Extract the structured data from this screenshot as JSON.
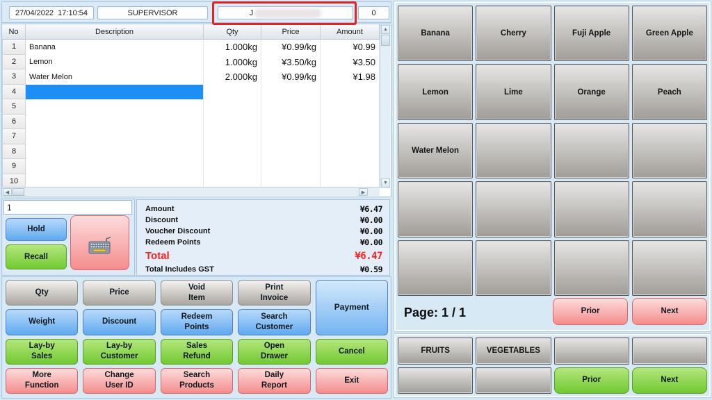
{
  "colors": {
    "selection_blue": "#1e8ef7",
    "annotation_red": "#e32222",
    "total_red": "#ff2020"
  },
  "topbar": {
    "datetime": "27/04/2022  17:10:54",
    "operator": "SUPERVISOR",
    "customer_name": "J",
    "counter": "0"
  },
  "sales_table": {
    "headers": [
      "No",
      "Description",
      "Qty",
      "Price",
      "Amount"
    ],
    "selected_row_no": "4",
    "rows": [
      {
        "no": "1",
        "description": "Banana",
        "qty": "1.000kg",
        "price": "¥0.99/kg",
        "amount": "¥0.99"
      },
      {
        "no": "2",
        "description": "Lemon",
        "qty": "1.000kg",
        "price": "¥3.50/kg",
        "amount": "¥3.50"
      },
      {
        "no": "3",
        "description": "Water Melon",
        "qty": "2.000kg",
        "price": "¥0.99/kg",
        "amount": "¥1.98"
      },
      {
        "no": "4",
        "description": "",
        "qty": "",
        "price": "",
        "amount": ""
      },
      {
        "no": "5",
        "description": "",
        "qty": "",
        "price": "",
        "amount": ""
      },
      {
        "no": "6",
        "description": "",
        "qty": "",
        "price": "",
        "amount": ""
      },
      {
        "no": "7",
        "description": "",
        "qty": "",
        "price": "",
        "amount": ""
      },
      {
        "no": "8",
        "description": "",
        "qty": "",
        "price": "",
        "amount": ""
      },
      {
        "no": "9",
        "description": "",
        "qty": "",
        "price": "",
        "amount": ""
      },
      {
        "no": "10",
        "description": "",
        "qty": "",
        "price": "",
        "amount": ""
      }
    ]
  },
  "entry": {
    "value": "1"
  },
  "side_actions": {
    "hold": "Hold",
    "recall": "Recall",
    "keyboard_icon": "keyboard-icon"
  },
  "summary": {
    "items": [
      {
        "label": "Amount",
        "value": "¥6.47"
      },
      {
        "label": "Discount",
        "value": "¥0.00"
      },
      {
        "label": "Voucher Discount",
        "value": "¥0.00"
      },
      {
        "label": "Redeem Points",
        "value": "¥0.00"
      }
    ],
    "total": {
      "label": "Total",
      "value": "¥6.47"
    },
    "gst": {
      "label": "Total Includes GST",
      "value": "¥0.59"
    }
  },
  "function_buttons": {
    "qty": "Qty",
    "price": "Price",
    "void_item": "Void\nItem",
    "print_invoice": "Print\nInvoice",
    "payment": "Payment",
    "weight": "Weight",
    "discount": "Discount",
    "redeem_points": "Redeem\nPoints",
    "search_customer": "Search\nCustomer",
    "layby_sales": "Lay-by\nSales",
    "layby_customer": "Lay-by\nCustomer",
    "sales_refund": "Sales\nRefund",
    "open_drawer": "Open\nDrawer",
    "cancel": "Cancel",
    "more_function": "More\nFunction",
    "change_user_id": "Change\nUser ID",
    "search_products": "Search\nProducts",
    "daily_report": "Daily\nReport",
    "exit": "Exit"
  },
  "product_grid": {
    "items": [
      "Banana",
      "Cherry",
      "Fuji Apple",
      "Green Apple",
      "Lemon",
      "Lime",
      "Orange",
      "Peach",
      "Water Melon",
      "",
      "",
      "",
      "",
      "",
      "",
      "",
      "",
      "",
      "",
      ""
    ],
    "page_label": "Page: 1 / 1",
    "prior": "Prior",
    "next": "Next"
  },
  "category_grid": {
    "items": [
      "FRUITS",
      "VEGETABLES",
      "",
      "",
      "",
      ""
    ],
    "prior": "Prior",
    "next": "Next"
  }
}
